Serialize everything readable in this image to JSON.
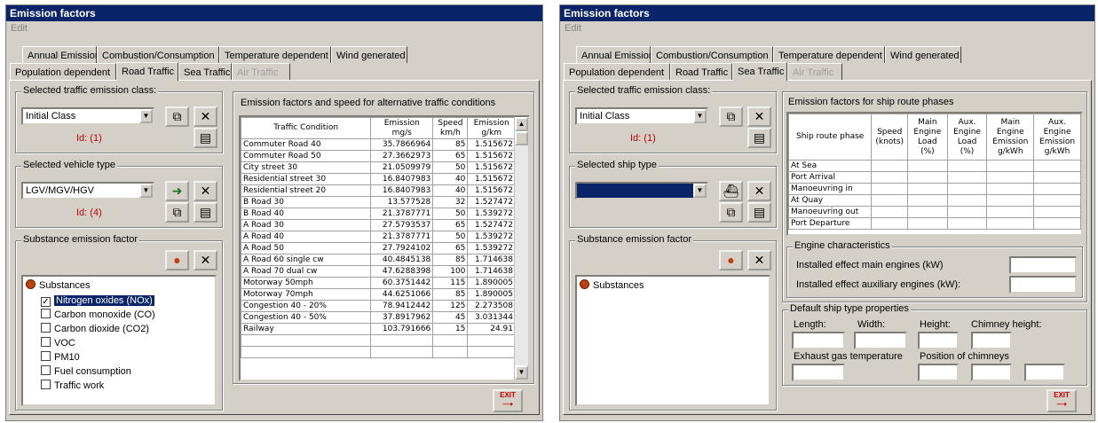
{
  "left": {
    "title": "Emission factors",
    "menu": "Edit",
    "tabs_row1": [
      "Annual Emission",
      "Combustion/Consumption",
      "Temperature dependent",
      "Wind generated"
    ],
    "tabs_row2": [
      "Population dependent",
      "Road Traffic",
      "Sea Traffic",
      "Air Traffic"
    ],
    "active_tab": "Road Traffic",
    "class_group": "Selected traffic emission class:",
    "class_value": "Initial Class",
    "class_id": "Id: (1)",
    "vehicle_group": "Selected vehicle type",
    "vehicle_value": "LGV/MGV/HGV",
    "vehicle_id": "Id: (4)",
    "substance_group": "Substance emission factor",
    "tree_root": "Substances",
    "substances": [
      {
        "label": "Nitrogen oxides (NOx)",
        "checked": true,
        "selected": true
      },
      {
        "label": "Carbon monoxide (CO)",
        "checked": false,
        "selected": false
      },
      {
        "label": "Carbon dioxide (CO2)",
        "checked": false,
        "selected": false
      },
      {
        "label": "VOC",
        "checked": false,
        "selected": false
      },
      {
        "label": "PM10",
        "checked": false,
        "selected": false
      },
      {
        "label": "Fuel consumption",
        "checked": false,
        "selected": false
      },
      {
        "label": "Traffic work",
        "checked": false,
        "selected": false
      }
    ],
    "factor_group": "Emission factors and speed for alternative traffic conditions",
    "columns": [
      "Traffic Condition",
      "Emission\nmg/s",
      "Speed\nkm/h",
      "Emission\ng/km"
    ],
    "rows": [
      [
        "Commuter Road 40",
        "35.7866964",
        "85",
        "1.515672"
      ],
      [
        "Commuter Road 50",
        "27.3662973",
        "65",
        "1.515672"
      ],
      [
        "City street 30",
        "21.0509979",
        "50",
        "1.515672"
      ],
      [
        "Residential street 30",
        "16.8407983",
        "40",
        "1.515672"
      ],
      [
        "Residential street 20",
        "16.8407983",
        "40",
        "1.515672"
      ],
      [
        "B Road 30",
        "13.577528",
        "32",
        "1.527472"
      ],
      [
        "B Road 40",
        "21.3787771",
        "50",
        "1.539272"
      ],
      [
        "A Road 30",
        "27.5793537",
        "65",
        "1.527472"
      ],
      [
        "A Road 40",
        "21.3787771",
        "50",
        "1.539272"
      ],
      [
        "A Road 50",
        "27.7924102",
        "65",
        "1.539272"
      ],
      [
        "A Road 60 single cw",
        "40.4845138",
        "85",
        "1.714638"
      ],
      [
        "A Road 70 dual cw",
        "47.6288398",
        "100",
        "1.714638"
      ],
      [
        "Motorway 50mph",
        "60.3751442",
        "115",
        "1.890005"
      ],
      [
        "Motorway 70mph",
        "44.6251066",
        "85",
        "1.890005"
      ],
      [
        "Congestion 40 - 20%",
        "78.9412442",
        "125",
        "2.273508"
      ],
      [
        "Congestion 40 - 50%",
        "37.8917962",
        "45",
        "3.031344"
      ],
      [
        "Railway",
        "103.791666",
        "15",
        "24.91"
      ]
    ],
    "exit_label": "EXIT"
  },
  "right": {
    "title": "Emission factors",
    "menu": "Edit",
    "tabs_row1": [
      "Annual Emission",
      "Combustion/Consumption",
      "Temperature dependent",
      "Wind generated"
    ],
    "tabs_row2": [
      "Population dependent",
      "Road Traffic",
      "Sea Traffic",
      "Air Traffic"
    ],
    "active_tab": "Sea Traffic",
    "class_group": "Selected traffic emission class:",
    "class_value": "Initial Class",
    "class_id": "Id: (1)",
    "ship_group": "Selected ship type",
    "ship_value": "",
    "substance_group": "Substance emission factor",
    "tree_root": "Substances",
    "phase_group": "Emission factors for ship route phases",
    "columns": [
      "Ship route phase",
      "Speed\n(knots)",
      "Main\nEngine\nLoad (%)",
      "Aux.\nEngine\nLoad (%)",
      "Main\nEngine\nEmission\ng/kWh",
      "Aux.\nEngine\nEmission\ng/kWh"
    ],
    "phases": [
      "At Sea",
      "Port Arrival",
      "Manoeuvring in",
      "At Quay",
      "Manoeuvring out",
      "Port Departure"
    ],
    "engine_group": "Engine characteristics",
    "engine_main": "Installed effect main engines (kW)",
    "engine_aux": "Installed effect auxiliary engines (kW):",
    "default_group": "Default ship type properties",
    "length": "Length:",
    "width": "Width:",
    "height": "Height:",
    "chimney_height": "Chimney height:",
    "exhaust": "Exhaust gas temperature",
    "position": "Position of chimneys",
    "exit_label": "EXIT"
  }
}
